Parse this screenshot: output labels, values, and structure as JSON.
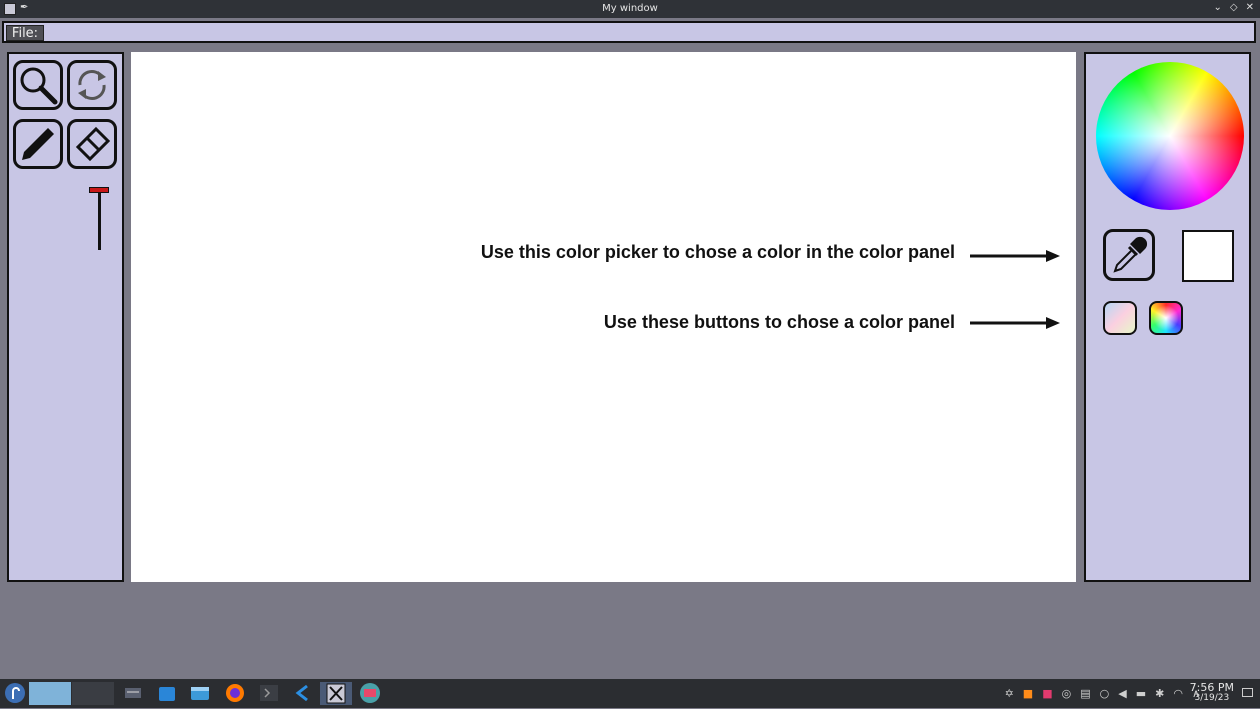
{
  "window": {
    "title": "My window"
  },
  "menu": {
    "file_label": "File:"
  },
  "tools": {
    "zoom": "magnifier-icon",
    "reset": "refresh-icon",
    "pencil": "pencil-icon",
    "eraser": "eraser-icon",
    "brush_size": 0.05
  },
  "annotations": {
    "picker_hint": "Use this color picker to chose a color in the color panel",
    "panel_hint": "Use these buttons to chose a color panel"
  },
  "color": {
    "selected": "#ffffff",
    "panel_buttons": [
      "soft-palette",
      "vivid-palette"
    ]
  },
  "colors": {
    "panel_bg": "#c8c6e5",
    "background": "#7a7986",
    "slider_thumb": "#c81818"
  },
  "taskbar": {
    "time": "7:56 PM",
    "date": "3/19/23"
  }
}
